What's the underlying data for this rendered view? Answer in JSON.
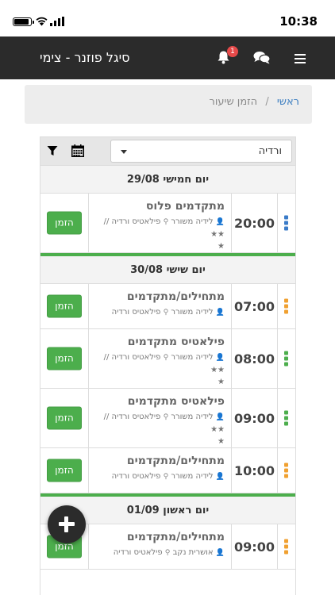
{
  "statusbar": {
    "time": "10:38"
  },
  "navbar": {
    "title": "סיגל פוזנר - צימי",
    "notification_count": "1"
  },
  "breadcrumb": {
    "home": "ראשי",
    "separator": "/",
    "current": "הזמן שיעור"
  },
  "filter": {
    "selected": "ורדיה"
  },
  "colors": {
    "green": "#4cae4c",
    "orange": "#f0a030",
    "blue": "#3a7bc8",
    "navbar": "#2b2b2b"
  },
  "days": [
    {
      "header": "יום חמישי 29/08",
      "classes": [
        {
          "time": "20:00",
          "name": "מתקדמים פלוס",
          "instructor": "לידיה משורר",
          "location": "פילאטיס ורדיה // ★★",
          "stars": "★",
          "handle_color": "blue",
          "button": "הזמן"
        }
      ]
    },
    {
      "header": "יום שישי 30/08",
      "classes": [
        {
          "time": "07:00",
          "name": "מתחילים/מתקדמים",
          "instructor": "לידיה משורר",
          "location": "פילאטיס ורדיה",
          "stars": "",
          "handle_color": "orange",
          "button": "הזמן"
        },
        {
          "time": "08:00",
          "name": "פילאטיס מתקדמים",
          "instructor": "לידיה משורר",
          "location": "פילאטיס ורדיה // ★★",
          "stars": "★",
          "handle_color": "green",
          "button": "הזמן"
        },
        {
          "time": "09:00",
          "name": "פילאטיס מתקדמים",
          "instructor": "לידיה משורר",
          "location": "פילאטיס ורדיה // ★★",
          "stars": "★",
          "handle_color": "green",
          "button": "הזמן"
        },
        {
          "time": "10:00",
          "name": "מתחילים/מתקדמים",
          "instructor": "לידיה משורר",
          "location": "פילאטיס ורדיה",
          "stars": "",
          "handle_color": "orange",
          "button": "הזמן"
        }
      ]
    },
    {
      "header": "יום ראשון 01/09",
      "classes": [
        {
          "time": "09:00",
          "name": "מתחילים/מתקדמים",
          "instructor": "אושרית נקב",
          "location": "פילאטיס ורדיה",
          "stars": "",
          "handle_color": "orange",
          "button": "הזמן"
        }
      ]
    }
  ]
}
